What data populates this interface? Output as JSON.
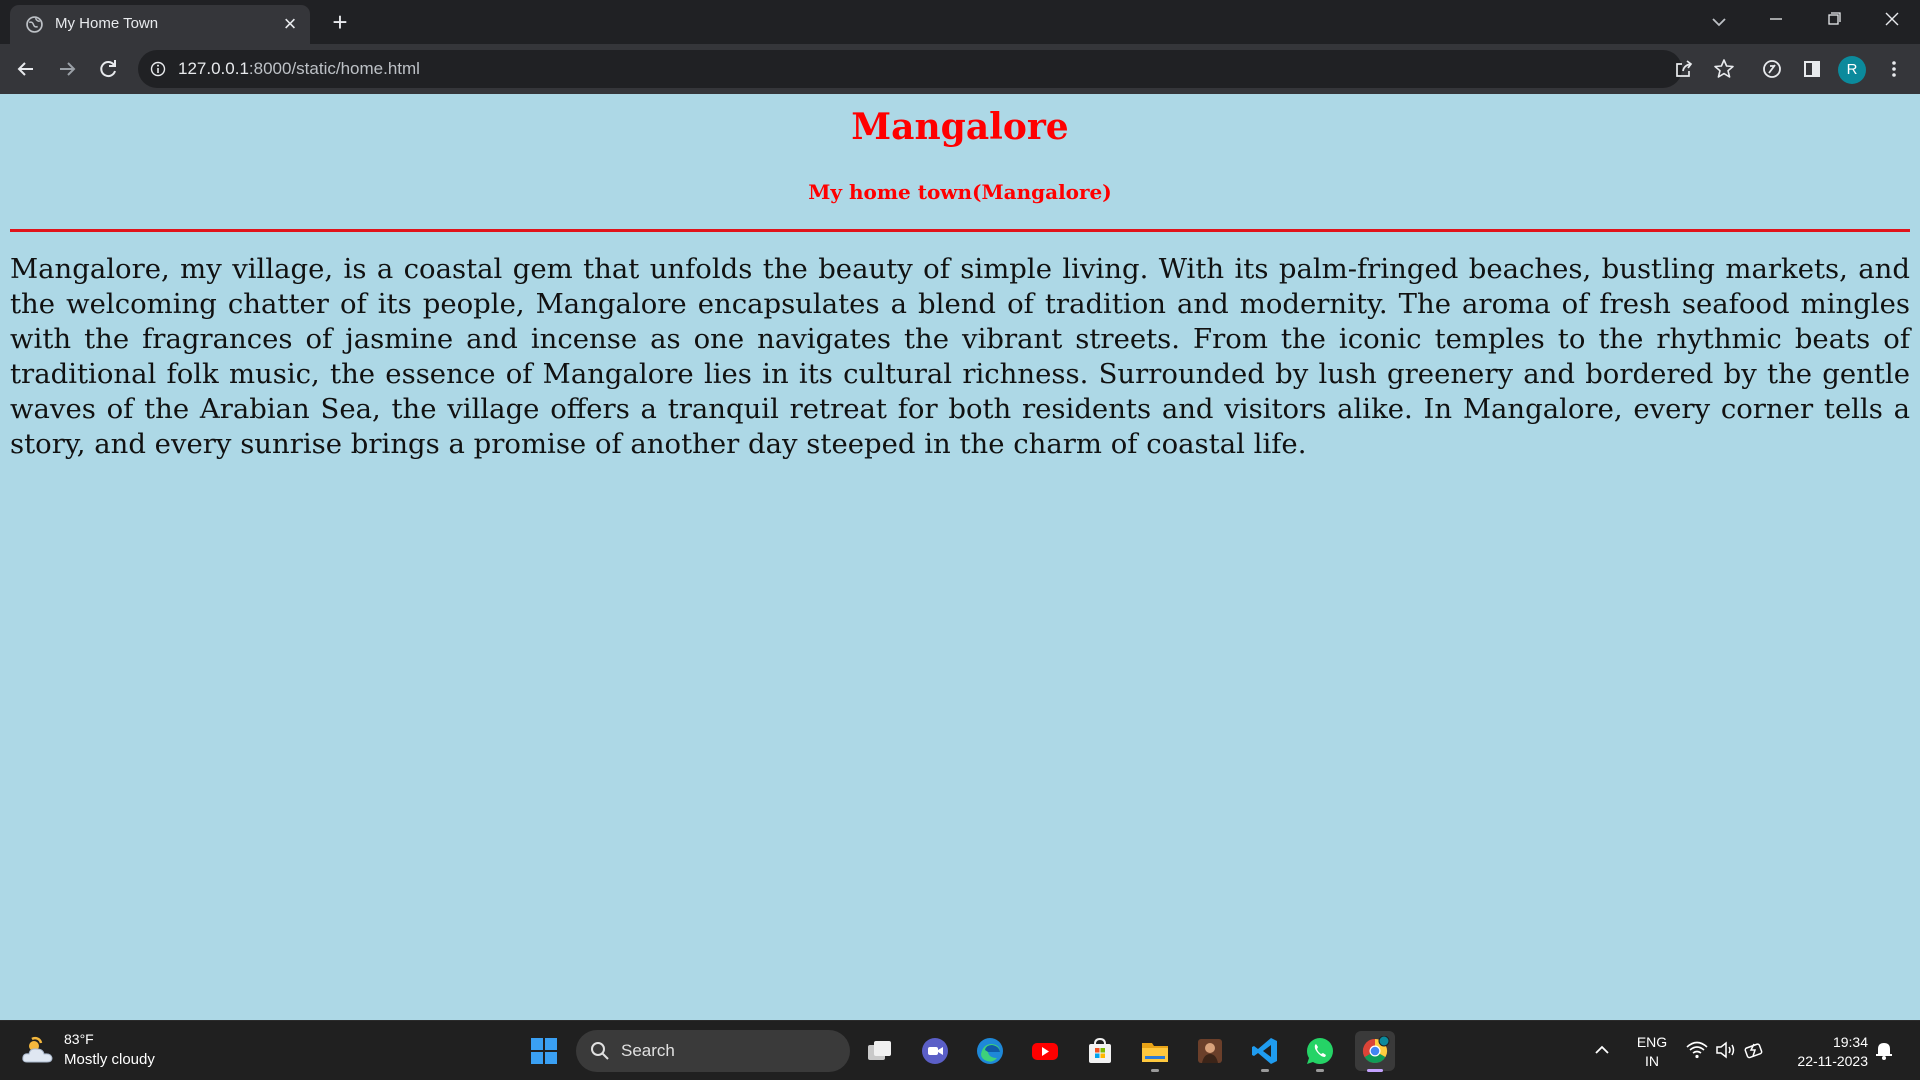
{
  "browser": {
    "tab_title": "My Home Town",
    "tab_close_glyph": "×",
    "new_tab_glyph": "+",
    "url_host": "127.0.0.1",
    "url_rest": ":8000/static/home.html",
    "profile_initial": "R",
    "profile_color": "#0b8a9c",
    "chrome_color": "#35363a",
    "tabstrip_color": "#202124"
  },
  "page": {
    "background_color": "#add8e6",
    "accent_color": "#ff0000",
    "title": "Mangalore",
    "subtitle": "My home town(Mangalore)",
    "paragraph": "Mangalore, my village, is a coastal gem that unfolds the beauty of simple living. With its palm-fringed beaches, bustling markets, and the welcoming chatter of its people, Mangalore encapsulates a blend of tradition and modernity. The aroma of fresh seafood mingles with the fragrances of jasmine and incense as one navigates the vibrant streets. From the iconic temples to the rhythmic beats of traditional folk music, the essence of Mangalore lies in its cultural richness. Surrounded by lush greenery and bordered by the gentle waves of the Arabian Sea, the village offers a tranquil retreat for both residents and visitors alike. In Mangalore, every corner tells a story, and every sunrise brings a promise of another day steeped in the charm of coastal life."
  },
  "taskbar": {
    "weather_temp": "83°F",
    "weather_desc": "Mostly cloudy",
    "search_label": "Search",
    "apps": [
      "start-icon",
      "task-view-icon",
      "meet-icon",
      "edge-icon",
      "youtube-icon",
      "store-icon",
      "file-explorer-icon",
      "photo-app-icon",
      "vscode-icon",
      "whatsapp-icon",
      "chrome-icon"
    ],
    "lang_line1": "ENG",
    "lang_line2": "IN",
    "time": "19:34",
    "date": "22-11-2023"
  }
}
